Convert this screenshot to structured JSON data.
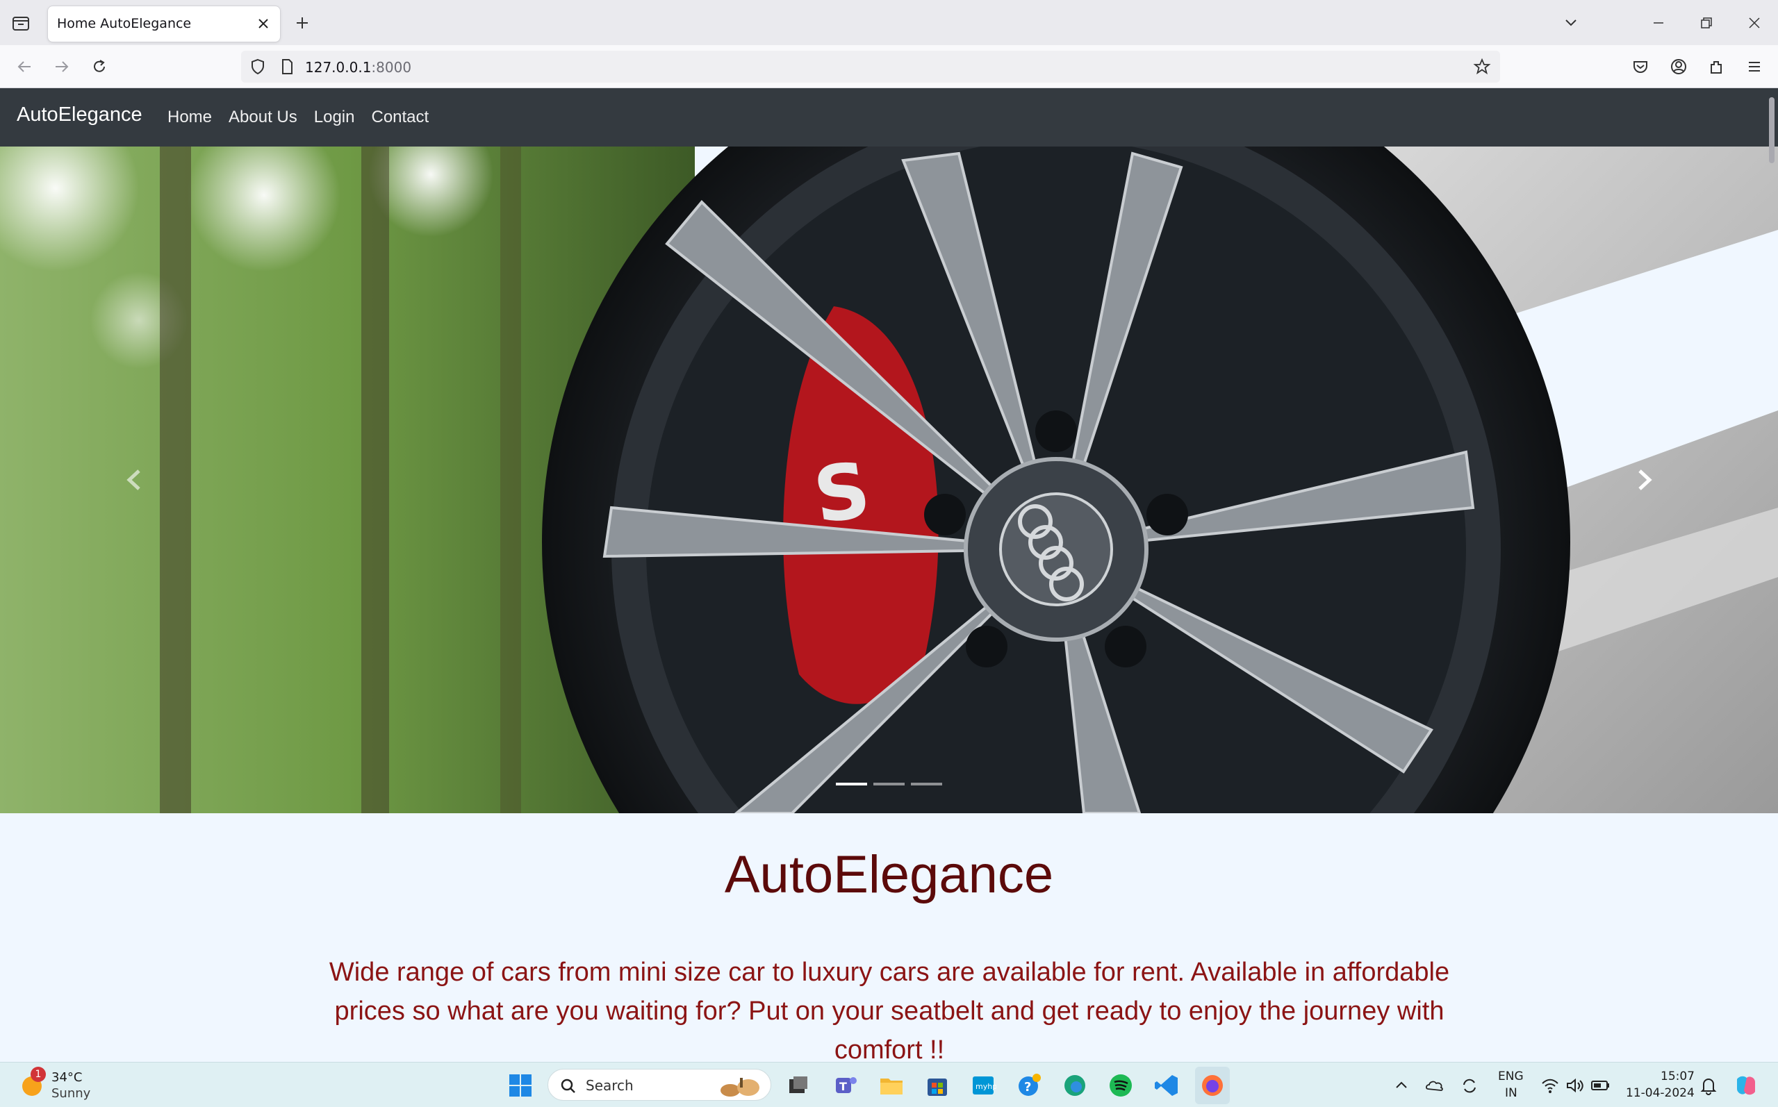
{
  "browser": {
    "tab_title": "Home AutoElegance",
    "url_host": "127.0.0.1",
    "url_port": ":8000"
  },
  "site": {
    "brand": "AutoElegance",
    "nav": [
      "Home",
      "About Us",
      "Login",
      "Contact"
    ],
    "headline": "AutoElegance",
    "intro": "Wide range of cars from mini size car to luxury cars are available for rent. Available in affordable prices so what are you waiting for? Put on your seatbelt and get ready to enjoy the journey with comfort !!",
    "carousel": {
      "slide_count": 3,
      "active_index": 0
    }
  },
  "taskbar": {
    "weather_temp": "34°C",
    "weather_condition": "Sunny",
    "weather_badge": "1",
    "search_label": "Search",
    "lang_top": "ENG",
    "lang_bottom": "IN",
    "time": "15:07",
    "date": "11-04-2024"
  },
  "colors": {
    "site_nav_bg": "#343a40",
    "headline": "#5c0a0a",
    "intro_text": "#8b1414",
    "page_bg": "#f0f7ff"
  }
}
